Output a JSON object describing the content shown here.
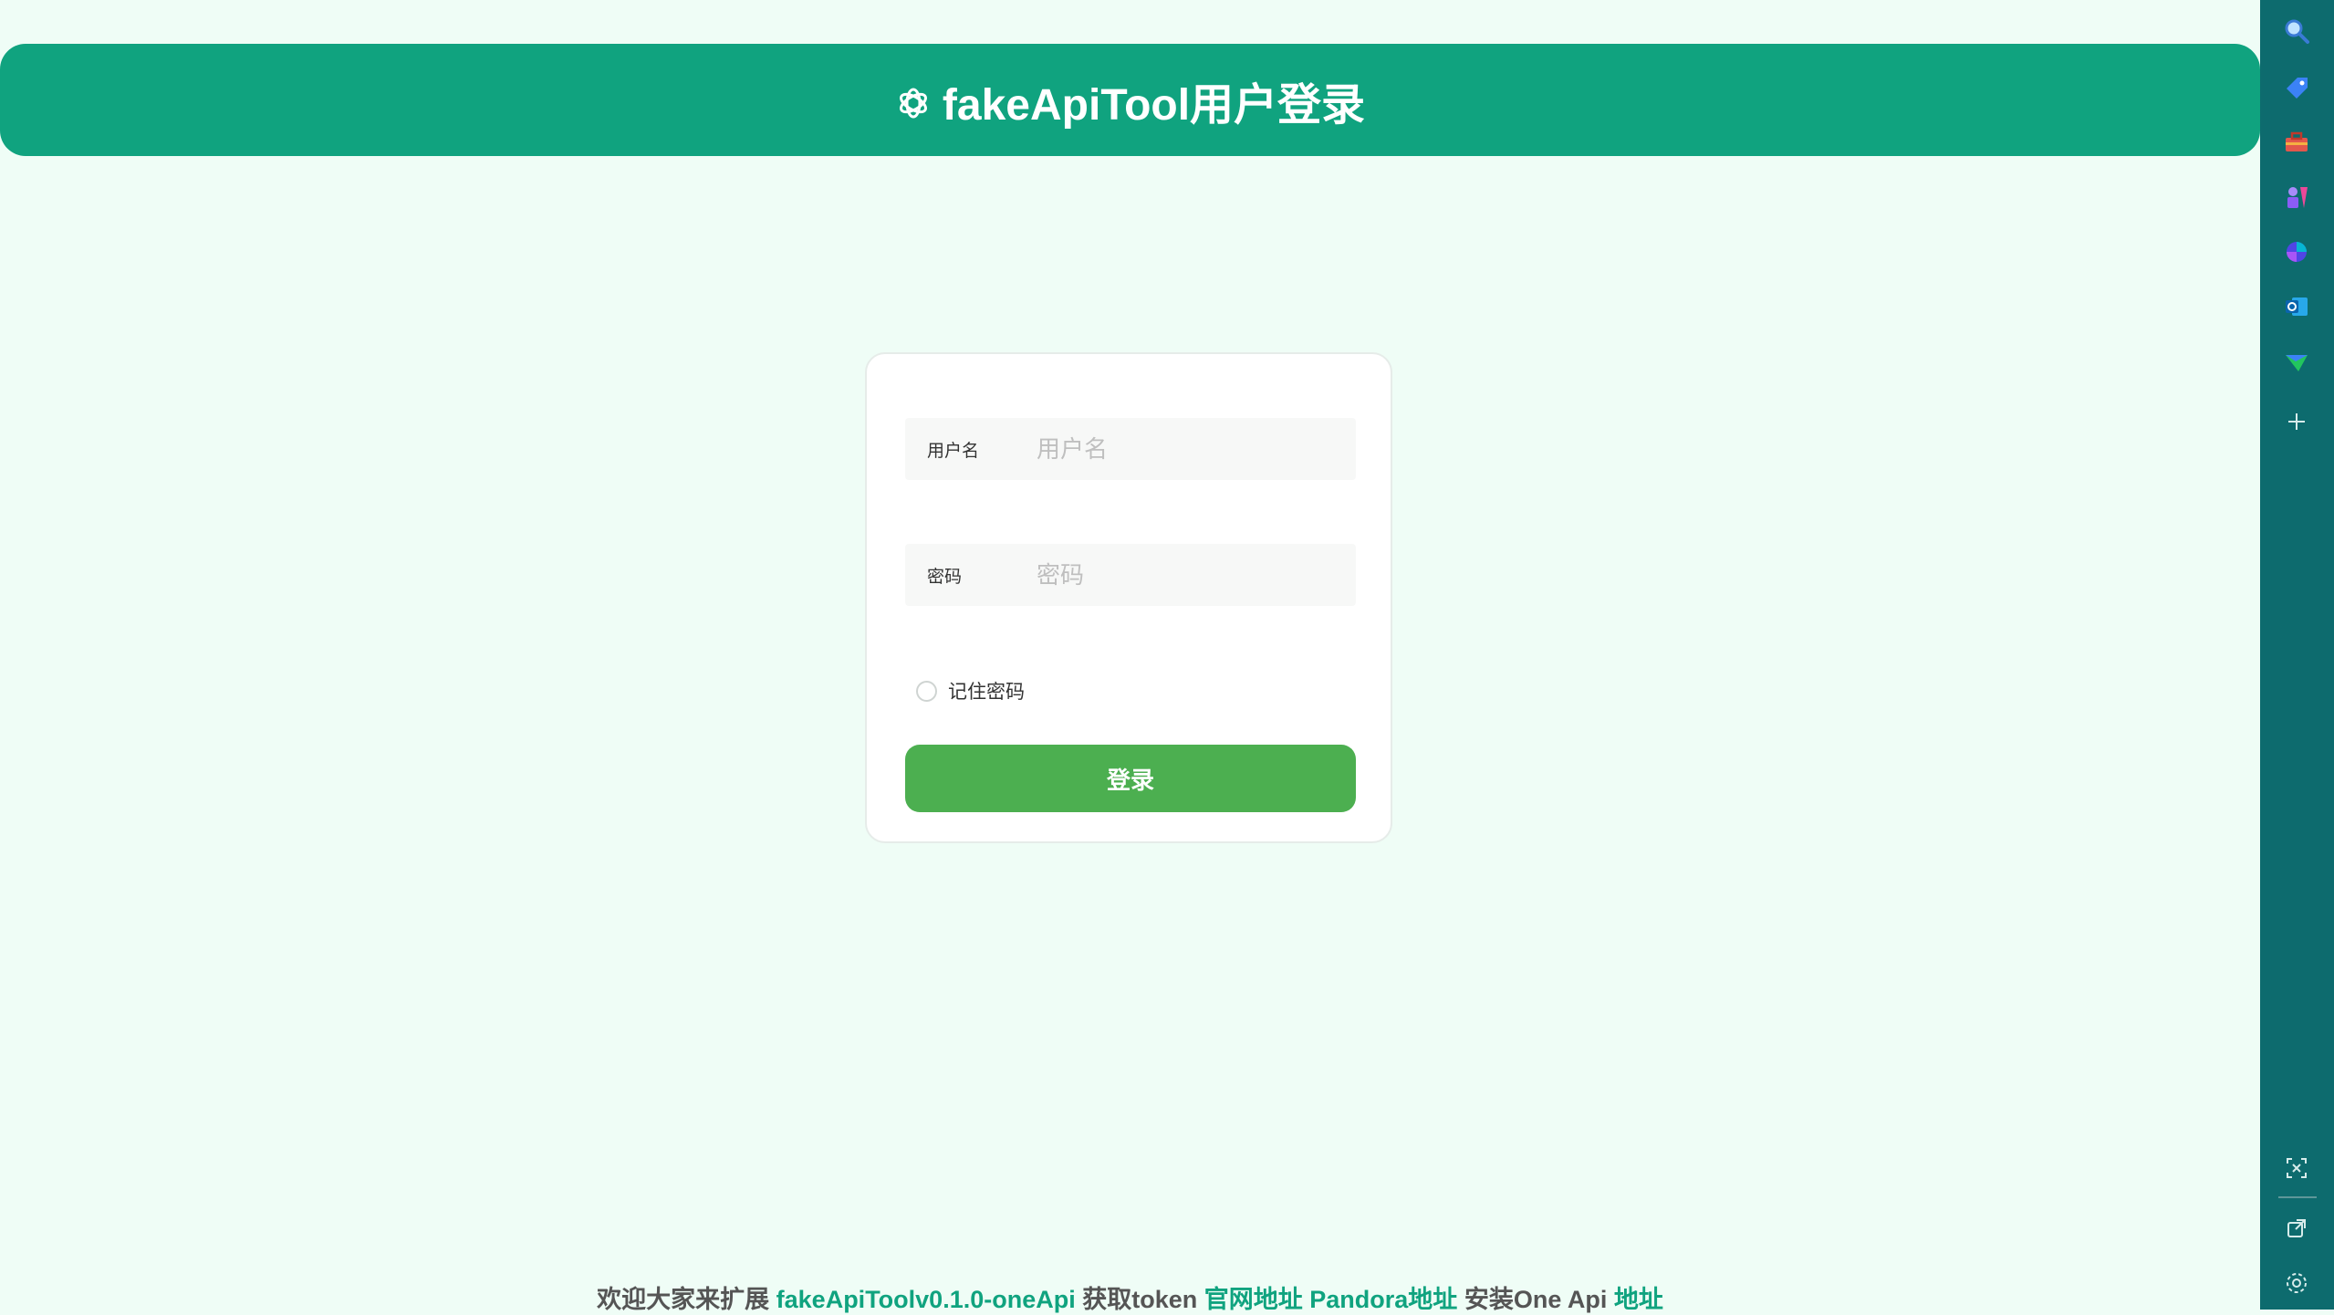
{
  "header": {
    "title": "fakeApiTool用户登录",
    "logo_icon": "openai-logo-icon"
  },
  "form": {
    "username_label": "用户名",
    "username_placeholder": "用户名",
    "password_label": "密码",
    "password_placeholder": "密码",
    "remember_label": "记住密码",
    "login_label": "登录"
  },
  "footer": {
    "prefix": "欢迎大家来扩展",
    "project_link": "fakeApiToolv0.1.0-oneApi",
    "token_text": "获取token",
    "official_link": "官网地址",
    "pandora_link": "Pandora地址",
    "install_text": "安装One Api",
    "address_link": "地址"
  },
  "sidebar": {
    "icons": [
      "search-icon",
      "tag-icon",
      "toolbox-icon",
      "chess-icon",
      "copilot-icon",
      "outlook-icon",
      "send-icon",
      "add-icon",
      "screenshot-icon",
      "open-external-icon",
      "settings-icon"
    ]
  },
  "colors": {
    "header": "#10a37f",
    "background": "#effdf6",
    "button": "#4caf50",
    "sidebar": "#0d6b6e",
    "link": "#10a37f"
  }
}
